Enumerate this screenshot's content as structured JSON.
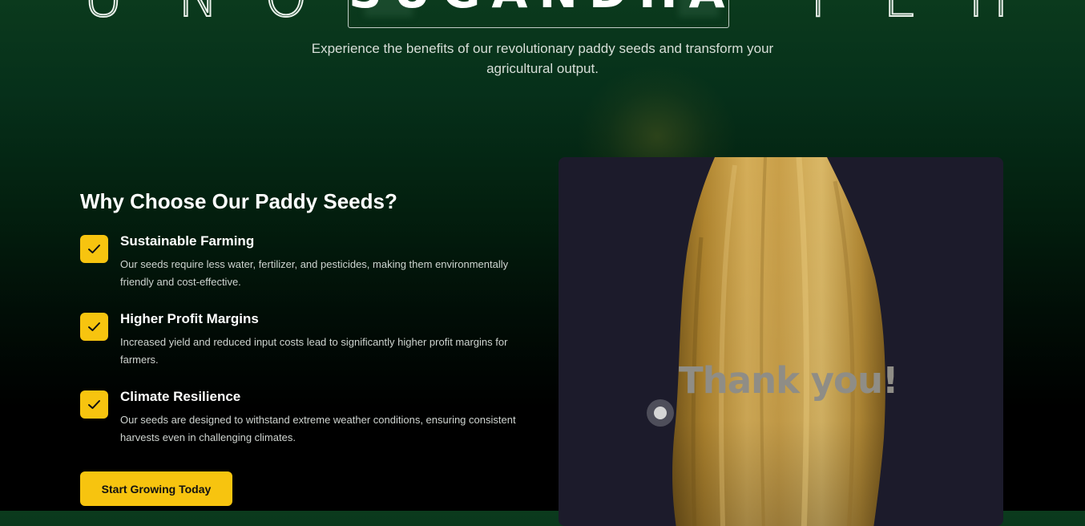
{
  "hero": {
    "letters_left": [
      "U",
      "N",
      "O"
    ],
    "brand": "SUGANDHA",
    "letters_right": [
      "T",
      "E",
      "H"
    ],
    "subtitle": "Experience the benefits of our revolutionary paddy seeds and transform your agricultural output."
  },
  "why": {
    "title": "Why Choose Our Paddy Seeds?",
    "features": [
      {
        "title": "Sustainable Farming",
        "text": "Our seeds require less water, fertilizer, and pesticides, making them environmentally friendly and cost-effective.",
        "icon": "check-icon"
      },
      {
        "title": "Higher Profit Margins",
        "text": "Increased yield and reduced input costs lead to significantly higher profit margins for farmers.",
        "icon": "check-icon"
      },
      {
        "title": "Climate Resilience",
        "text": "Our seeds are designed to withstand extreme weather conditions, ensuring consistent harvests even in challenging climates.",
        "icon": "check-icon"
      }
    ],
    "cta_label": "Start Growing Today"
  },
  "showcase": {
    "overlay_text": "Thank you!",
    "image": "paddy-grain-closeup"
  },
  "colors": {
    "accent": "#f7c40f",
    "panel": "#1c1b2b",
    "background_top": "#0b3a1d",
    "background_bottom": "#000000"
  }
}
